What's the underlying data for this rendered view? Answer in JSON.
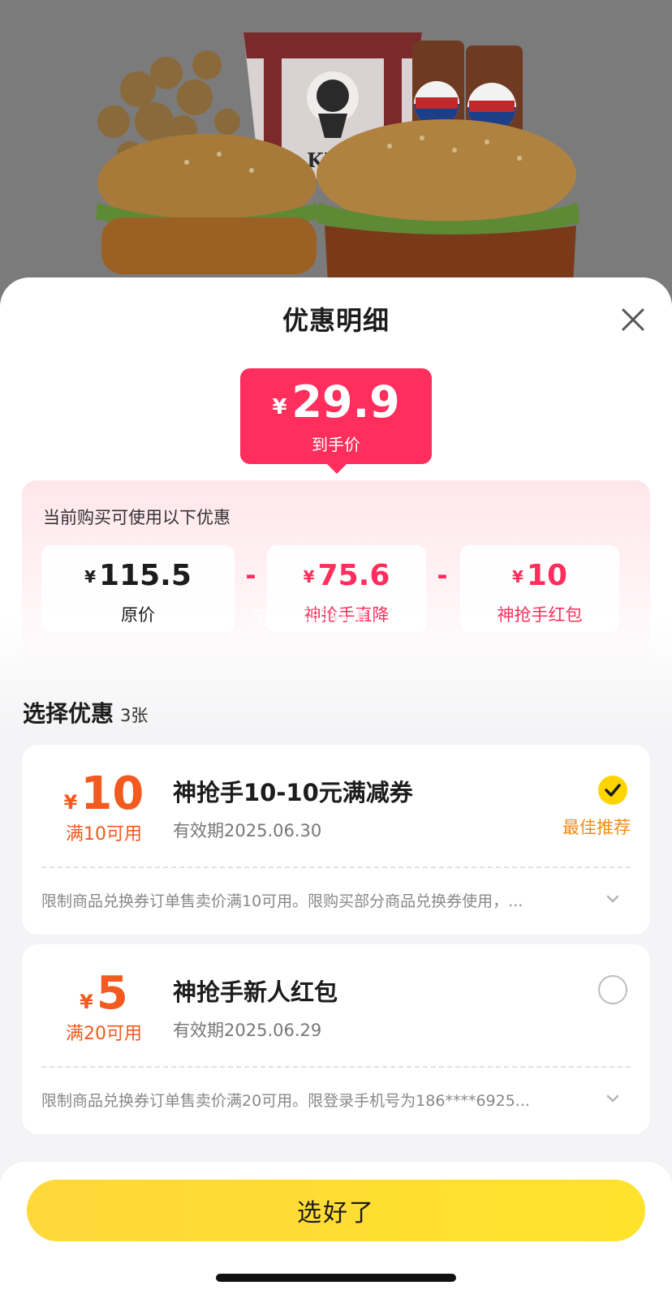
{
  "hero": {
    "brand_text": "KFC",
    "drink_text": "百事可乐"
  },
  "sheet": {
    "title": "优惠明细",
    "close_icon": "close-icon"
  },
  "price": {
    "currency": "¥",
    "value": "29.9",
    "label": "到手价"
  },
  "breakdown": {
    "title": "当前购买可使用以下优惠",
    "original": {
      "currency": "¥",
      "value": "115.5",
      "label": "原价"
    },
    "direct_cut": {
      "currency": "¥",
      "value": "75.6",
      "label": "神抢手直降"
    },
    "red_packet": {
      "currency": "¥",
      "value": "10",
      "label": "神抢手红包"
    },
    "minus": "-",
    "watermark": "穷得不明办事"
  },
  "coupons_section": {
    "title": "选择优惠",
    "count": "3张"
  },
  "coupons": [
    {
      "currency": "¥",
      "amount": "10",
      "condition": "满10可用",
      "name": "神抢手10-10元满减券",
      "valid": "有效期2025.06.30",
      "tag": "最佳推荐",
      "selected": true,
      "desc": "限制商品兑换券订单售卖价满10可用。限购买部分商品兑换券使用，..."
    },
    {
      "currency": "¥",
      "amount": "5",
      "condition": "满20可用",
      "name": "神抢手新人红包",
      "valid": "有效期2025.06.29",
      "selected": false,
      "desc": "限制商品兑换券订单售卖价满20可用。限登录手机号为186****6925..."
    }
  ],
  "footer": {
    "confirm_label": "选好了"
  },
  "colors": {
    "accent_pink": "#ff2e5c",
    "coupon_orange": "#f25a1f",
    "button_yellow": "#ffdc35",
    "tag_orange": "#f28c16"
  }
}
